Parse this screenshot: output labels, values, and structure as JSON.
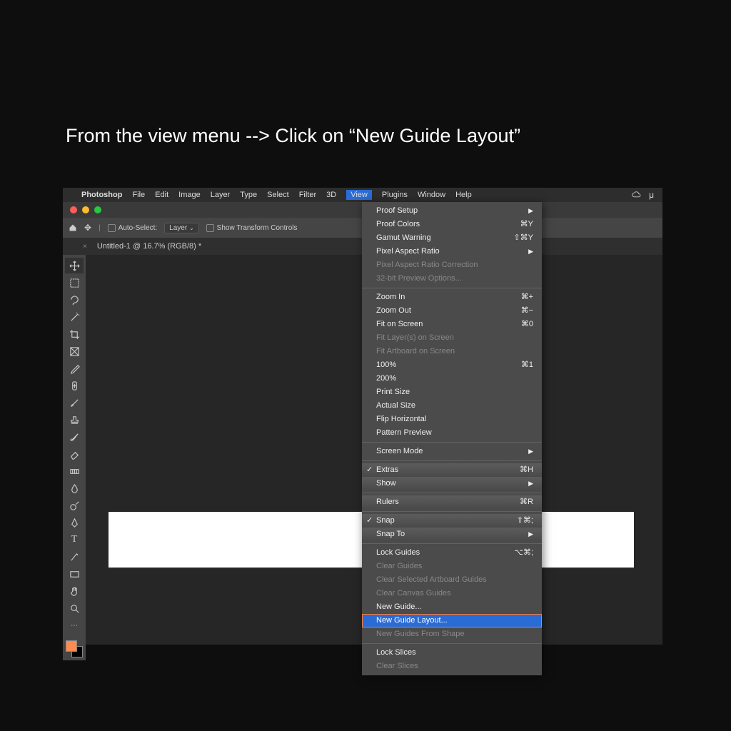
{
  "instruction": "From the view menu --> Click on “New Guide Layout”",
  "menubar": {
    "app": "Photoshop",
    "items": [
      "File",
      "Edit",
      "Image",
      "Layer",
      "Type",
      "Select",
      "Filter",
      "3D",
      "View",
      "Plugins",
      "Window",
      "Help"
    ]
  },
  "options_bar": {
    "auto_select": "Auto-Select:",
    "layer_dropdown": "Layer",
    "show_transform": "Show Transform Controls"
  },
  "tab": "Untitled-1 @ 16.7% (RGB/8) *",
  "colors": {
    "fg": "#ff8a50",
    "bg": "#000000"
  },
  "view_menu": {
    "groups": [
      [
        {
          "label": "Proof Setup",
          "sc": "",
          "arrow": true
        },
        {
          "label": "Proof Colors",
          "sc": "⌘Y"
        },
        {
          "label": "Gamut Warning",
          "sc": "⇧⌘Y"
        },
        {
          "label": "Pixel Aspect Ratio",
          "sc": "",
          "arrow": true
        },
        {
          "label": "Pixel Aspect Ratio Correction",
          "disabled": true
        },
        {
          "label": "32-bit Preview Options...",
          "disabled": true
        }
      ],
      [
        {
          "label": "Zoom In",
          "sc": "⌘+"
        },
        {
          "label": "Zoom Out",
          "sc": "⌘−"
        },
        {
          "label": "Fit on Screen",
          "sc": "⌘0"
        },
        {
          "label": "Fit Layer(s) on Screen",
          "disabled": true
        },
        {
          "label": "Fit Artboard on Screen",
          "disabled": true
        },
        {
          "label": "100%",
          "sc": "⌘1"
        },
        {
          "label": "200%"
        },
        {
          "label": "Print Size"
        },
        {
          "label": "Actual Size"
        },
        {
          "label": "Flip Horizontal"
        },
        {
          "label": "Pattern Preview"
        }
      ],
      [
        {
          "label": "Screen Mode",
          "arrow": true
        }
      ],
      [
        {
          "label": "Extras",
          "sc": "⌘H",
          "check": true,
          "gradient": true
        },
        {
          "label": "Show",
          "arrow": true,
          "gradient": true
        }
      ],
      [
        {
          "label": "Rulers",
          "sc": "⌘R",
          "gradient": true
        }
      ],
      [
        {
          "label": "Snap",
          "sc": "⇧⌘;",
          "check": true,
          "gradient": true
        },
        {
          "label": "Snap To",
          "arrow": true,
          "gradient": true
        }
      ],
      [
        {
          "label": "Lock Guides",
          "sc": "⌥⌘;"
        },
        {
          "label": "Clear Guides",
          "disabled": true
        },
        {
          "label": "Clear Selected Artboard Guides",
          "disabled": true
        },
        {
          "label": "Clear Canvas Guides",
          "disabled": true
        },
        {
          "label": "New Guide..."
        },
        {
          "label": "New Guide Layout...",
          "highlighted": true
        },
        {
          "label": "New Guides From Shape",
          "disabled": true
        }
      ],
      [
        {
          "label": "Lock Slices"
        },
        {
          "label": "Clear Slices",
          "disabled": true
        }
      ]
    ]
  }
}
